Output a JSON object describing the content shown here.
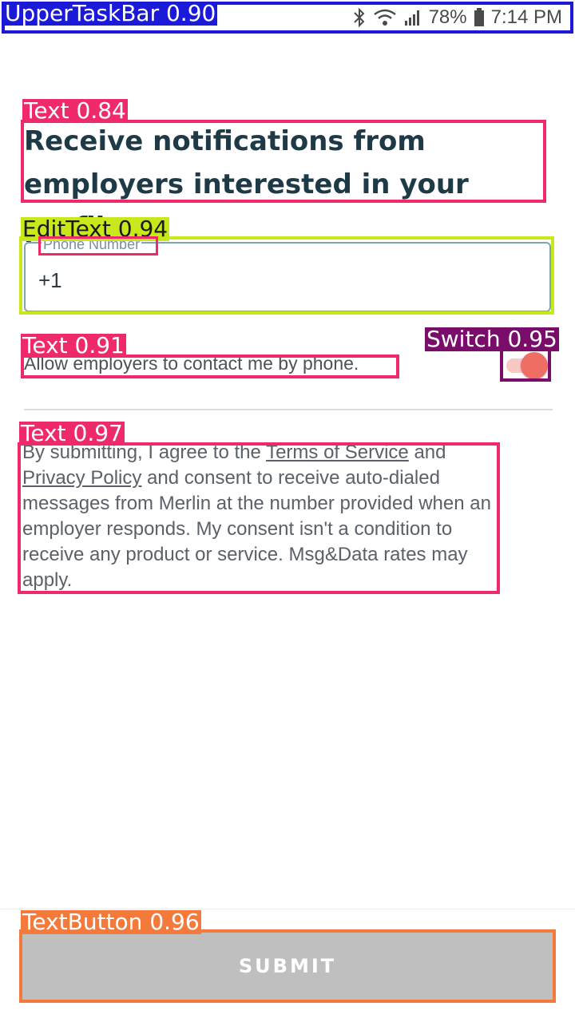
{
  "status_bar": {
    "battery": "78%",
    "time": "7:14 PM",
    "icons": [
      "bluetooth-icon",
      "wifi-icon",
      "signal-icon",
      "battery-icon"
    ]
  },
  "annotations": {
    "upper_task_bar": "UpperTaskBar 0.90",
    "heading": "Text 0.84",
    "phone_edit": "EditText 0.94",
    "allow_text": "Text 0.91",
    "switch": "Switch 0.95",
    "legal_text": "Text 0.97",
    "submit": "TextButton 0.96"
  },
  "colors": {
    "accent": "#ee6e63",
    "heading": "#1e3a46",
    "submit_disabled": "#bfbfbf"
  },
  "form": {
    "heading": "Receive notifications from employers interested in your profile",
    "phone_label": "Phone Number",
    "phone_value": "+1",
    "allow_label": "Allow employers to contact me by phone.",
    "switch_on": true,
    "legal_prefix": "By submitting, I agree to the ",
    "terms_link": "Terms of Service",
    "legal_and": " and ",
    "privacy_link": "Privacy Policy",
    "legal_suffix": " and consent to receive auto-dialed messages from Merlin at the number provided when an employer responds. My consent isn't a condition to receive any product or service. Msg&Data rates may apply.",
    "submit_label": "SUBMIT"
  }
}
